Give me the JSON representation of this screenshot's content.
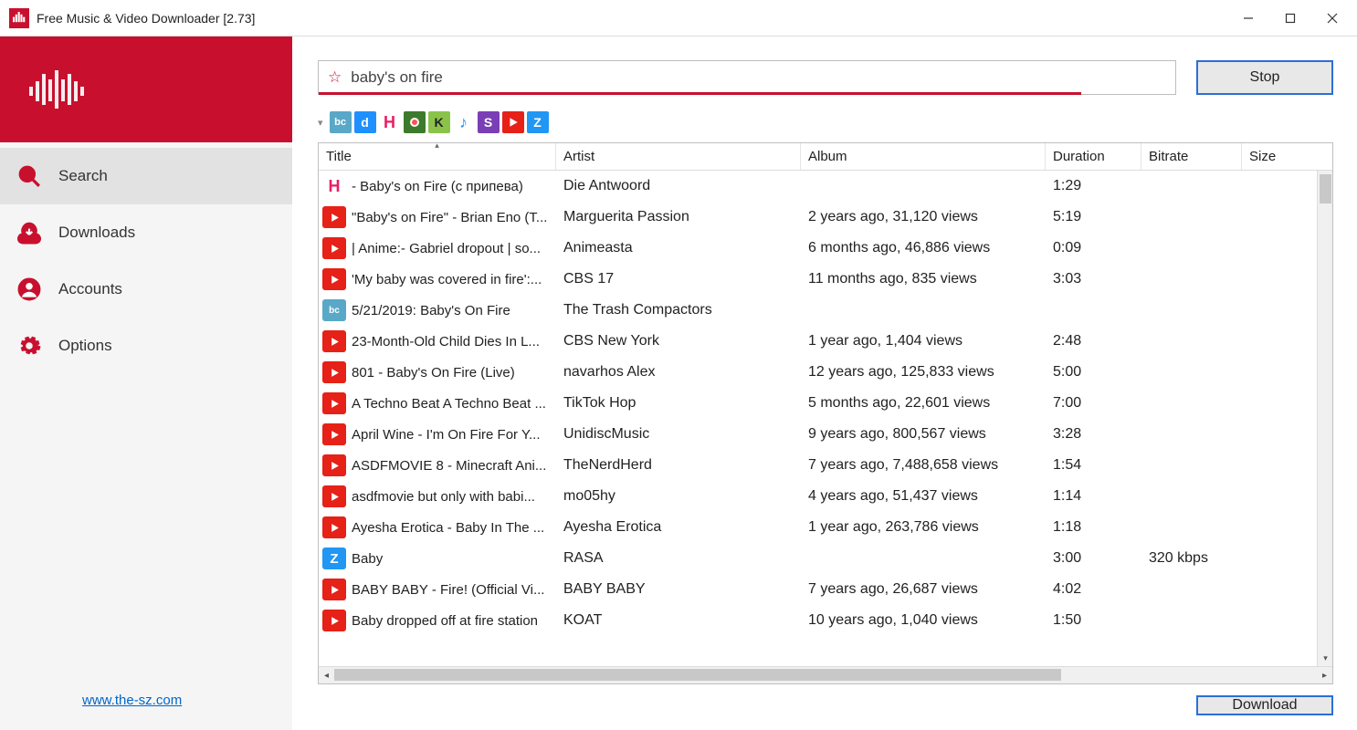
{
  "window": {
    "title": "Free Music & Video Downloader [2.73]"
  },
  "sidebar": {
    "items": [
      {
        "label": "Search"
      },
      {
        "label": "Downloads"
      },
      {
        "label": "Accounts"
      },
      {
        "label": "Options"
      }
    ],
    "link": "www.the-sz.com"
  },
  "search": {
    "value": "baby's on fire",
    "stop_label": "Stop",
    "download_label": "Download"
  },
  "columns": {
    "title": "Title",
    "artist": "Artist",
    "album": "Album",
    "duration": "Duration",
    "bitrate": "Bitrate",
    "size": "Size"
  },
  "rows": [
    {
      "src": "h",
      "title": " - Baby's on Fire (с припева)",
      "artist": "Die Antwoord",
      "album": "",
      "duration": "1:29",
      "bitrate": "",
      "size": ""
    },
    {
      "src": "yt",
      "title": "\"Baby's on Fire\" - Brian Eno (T...",
      "artist": "Marguerita Passion",
      "album": "2 years ago, 31,120 views",
      "duration": "5:19",
      "bitrate": "",
      "size": ""
    },
    {
      "src": "yt",
      "title": "| Anime:- Gabriel dropout | so...",
      "artist": "Animeasta",
      "album": "6 months ago, 46,886 views",
      "duration": "0:09",
      "bitrate": "",
      "size": ""
    },
    {
      "src": "yt",
      "title": "'My baby was covered in fire':...",
      "artist": "CBS 17",
      "album": "11 months ago, 835 views",
      "duration": "3:03",
      "bitrate": "",
      "size": ""
    },
    {
      "src": "bc",
      "title": "5/21/2019:  Baby's On Fire",
      "artist": "The Trash Compactors",
      "album": "",
      "duration": "",
      "bitrate": "",
      "size": ""
    },
    {
      "src": "yt",
      "title": "23-Month-Old Child Dies In L...",
      "artist": "CBS New York",
      "album": "1 year ago, 1,404 views",
      "duration": "2:48",
      "bitrate": "",
      "size": ""
    },
    {
      "src": "yt",
      "title": "801 - Baby's On Fire (Live)",
      "artist": "navarhos Alex",
      "album": "12 years ago, 125,833 views",
      "duration": "5:00",
      "bitrate": "",
      "size": ""
    },
    {
      "src": "yt",
      "title": "A Techno Beat A Techno Beat ...",
      "artist": "TikTok Hop",
      "album": "5 months ago, 22,601 views",
      "duration": "7:00",
      "bitrate": "",
      "size": ""
    },
    {
      "src": "yt",
      "title": "April Wine - I'm On Fire For Y...",
      "artist": "UnidiscMusic",
      "album": "9 years ago, 800,567 views",
      "duration": "3:28",
      "bitrate": "",
      "size": ""
    },
    {
      "src": "yt",
      "title": "ASDFMOVIE 8 - Minecraft Ani...",
      "artist": "TheNerdHerd",
      "album": "7 years ago, 7,488,658 views",
      "duration": "1:54",
      "bitrate": "",
      "size": ""
    },
    {
      "src": "yt",
      "title": "asdfmovie but only with babi...",
      "artist": "mo05hy",
      "album": "4 years ago, 51,437 views",
      "duration": "1:14",
      "bitrate": "",
      "size": ""
    },
    {
      "src": "yt",
      "title": "Ayesha Erotica - Baby In The ...",
      "artist": "Ayesha Erotica",
      "album": "1 year ago, 263,786 views",
      "duration": "1:18",
      "bitrate": "",
      "size": ""
    },
    {
      "src": "z",
      "title": "Baby",
      "artist": "RASA",
      "album": "",
      "duration": "3:00",
      "bitrate": "320 kbps",
      "size": ""
    },
    {
      "src": "yt",
      "title": "BABY BABY - Fire! (Official Vi...",
      "artist": "BABY BABY",
      "album": "7 years ago, 26,687 views",
      "duration": "4:02",
      "bitrate": "",
      "size": ""
    },
    {
      "src": "yt",
      "title": "Baby dropped off at fire station",
      "artist": "KOAT",
      "album": "10 years ago, 1,040 views",
      "duration": "1:50",
      "bitrate": "",
      "size": ""
    }
  ]
}
